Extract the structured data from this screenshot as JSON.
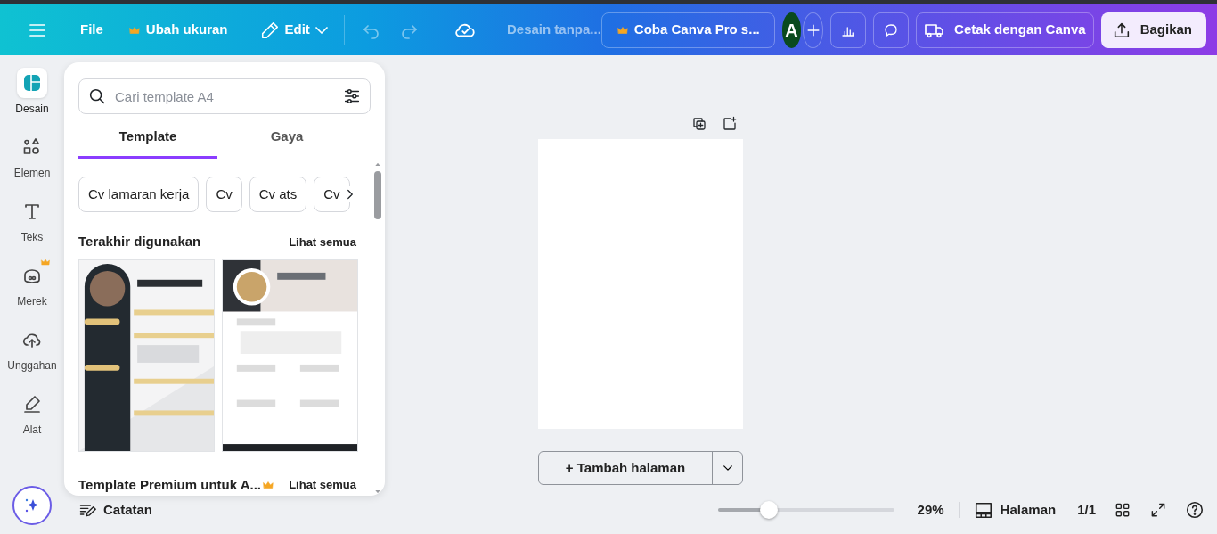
{
  "header": {
    "menu_label": "File",
    "resize": {
      "label": "Ubah ukuran",
      "premium": true
    },
    "edit": {
      "label": "Edit"
    },
    "history": [
      {
        "kind": "undo",
        "disabled": true
      },
      {
        "kind": "redo",
        "disabled": true
      }
    ],
    "title": "Desain tanpa...",
    "pro_button": {
      "label": "Coba Canva Pro s...",
      "premium": true
    },
    "avatar": {
      "initial": "A",
      "color": "#0a4a1e"
    },
    "print_button": "Cetak dengan Canva",
    "share_button": "Bagikan"
  },
  "sidebar": {
    "items": [
      {
        "label": "Desain",
        "kind": "design",
        "selected": true,
        "premium": false
      },
      {
        "label": "Elemen",
        "kind": "elements",
        "selected": false,
        "premium": false
      },
      {
        "label": "Teks",
        "kind": "text",
        "selected": false,
        "premium": false
      },
      {
        "label": "Merek",
        "kind": "brand",
        "selected": false,
        "premium": true
      },
      {
        "label": "Unggahan",
        "kind": "uploads",
        "selected": false,
        "premium": false
      },
      {
        "label": "Alat",
        "kind": "tools",
        "selected": false,
        "premium": false
      }
    ]
  },
  "panel": {
    "search": {
      "placeholder": "Cari template A4"
    },
    "tabs": [
      {
        "label": "Template",
        "selected": true
      },
      {
        "label": "Gaya",
        "selected": false
      }
    ],
    "chips": [
      "Cv lamaran kerja",
      "Cv",
      "Cv ats",
      "Cv"
    ],
    "sections": [
      {
        "title": "Terakhir digunakan",
        "premium": false,
        "link": "Lihat semua"
      },
      {
        "title": "Template Premium untuk A...",
        "premium": true,
        "link": "Lihat semua"
      }
    ]
  },
  "canvas": {
    "add_page": "+ Tambah halaman"
  },
  "status_bar": {
    "notes": "Catatan",
    "zoom": {
      "level": 0.29,
      "reading": "29%"
    },
    "pages_label": "Halaman",
    "page_count": "1/1"
  }
}
